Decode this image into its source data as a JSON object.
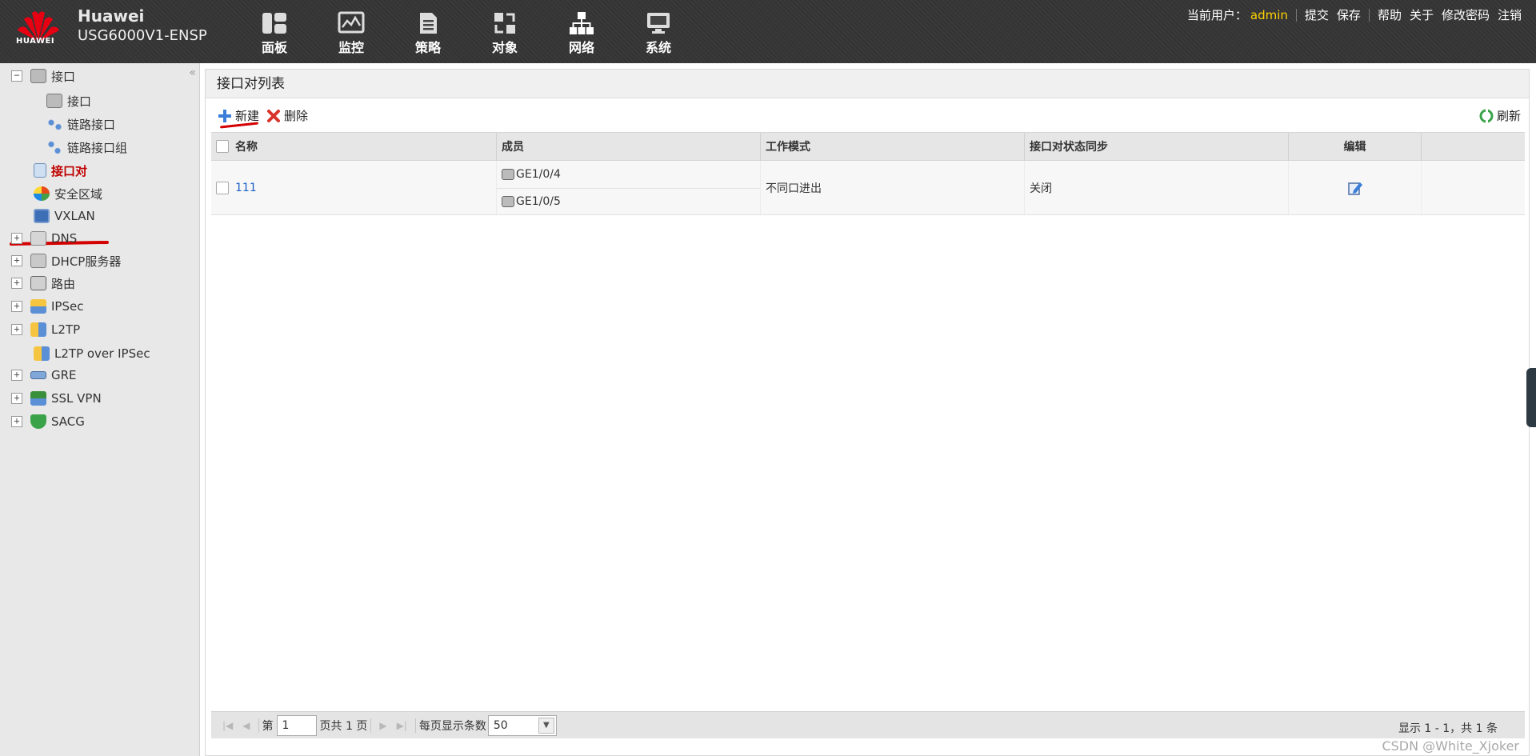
{
  "header": {
    "logo_text": "HUAWEI",
    "brand": "Huawei",
    "model": "USG6000V1-ENSP",
    "nav": [
      {
        "label": "面板",
        "icon": "dashboard-icon"
      },
      {
        "label": "监控",
        "icon": "monitor-icon"
      },
      {
        "label": "策略",
        "icon": "policy-icon"
      },
      {
        "label": "对象",
        "icon": "object-icon"
      },
      {
        "label": "网络",
        "icon": "network-icon"
      },
      {
        "label": "系统",
        "icon": "system-icon"
      }
    ],
    "current_user_label": "当前用户：",
    "current_user": "admin",
    "links": {
      "commit": "提交",
      "save": "保存",
      "help": "帮助",
      "about": "关于",
      "change_password": "修改密码",
      "logout": "注销"
    },
    "colors": {
      "user": "#ffd200"
    }
  },
  "sidebar": {
    "items": [
      {
        "label": "接口",
        "icon": "interface-icon"
      },
      {
        "label": "接口",
        "icon": "interface-icon"
      },
      {
        "label": "链路接口",
        "icon": "link-interface-icon"
      },
      {
        "label": "链路接口组",
        "icon": "link-interface-group-icon"
      },
      {
        "label": "接口对",
        "icon": "interface-pair-icon"
      },
      {
        "label": "安全区域",
        "icon": "security-zone-icon"
      },
      {
        "label": "VXLAN",
        "icon": "vxlan-icon"
      },
      {
        "label": "DNS",
        "icon": "dns-icon"
      },
      {
        "label": "DHCP服务器",
        "icon": "dhcp-icon"
      },
      {
        "label": "路由",
        "icon": "route-icon"
      },
      {
        "label": "IPSec",
        "icon": "ipsec-icon"
      },
      {
        "label": "L2TP",
        "icon": "l2tp-icon"
      },
      {
        "label": "L2TP over IPSec",
        "icon": "l2tp-ipsec-icon"
      },
      {
        "label": "GRE",
        "icon": "gre-icon"
      },
      {
        "label": "SSL VPN",
        "icon": "sslvpn-icon"
      },
      {
        "label": "SACG",
        "icon": "sacg-icon"
      }
    ],
    "colors": {
      "active": "#c00000"
    }
  },
  "main": {
    "title": "接口对列表",
    "toolbar": {
      "new": "新建",
      "delete": "删除",
      "refresh": "刷新"
    },
    "columns": [
      "名称",
      "成员",
      "工作模式",
      "接口对状态同步",
      "编辑"
    ],
    "rows": [
      {
        "name": "111",
        "members": [
          "GE1/0/4",
          "GE1/0/5"
        ],
        "mode": "不同口进出",
        "sync": "关闭"
      }
    ],
    "pager": {
      "page_prefix": "第",
      "page": "1",
      "page_suffix": "页共 1 页",
      "per_page_label": "每页显示条数",
      "per_page": "50",
      "summary": "显示 1 - 1，共 1 条"
    }
  },
  "watermark": "CSDN @White_Xjoker"
}
